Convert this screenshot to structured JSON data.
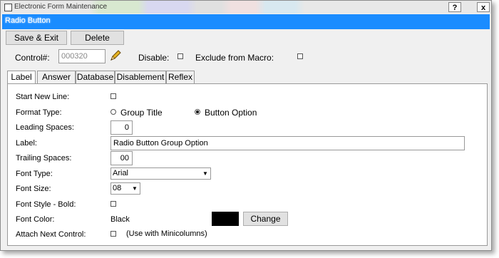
{
  "window": {
    "title": "Electronic Form Maintenance",
    "help_button": "?",
    "close_button": "x"
  },
  "header": {
    "title": "Radio Button"
  },
  "toolbar": {
    "save_exit_label": "Save & Exit",
    "delete_label": "Delete"
  },
  "control": {
    "control_label": "Control#:",
    "control_value": "000320",
    "disable_label": "Disable:",
    "disable_checked": false,
    "exclude_label": "Exclude from Macro:",
    "exclude_checked": false
  },
  "tabs": [
    {
      "label": "Label",
      "active": true
    },
    {
      "label": "Answer",
      "active": false
    },
    {
      "label": "Database",
      "active": false
    },
    {
      "label": "Disablement",
      "active": false
    },
    {
      "label": "Reflex",
      "active": false
    }
  ],
  "form": {
    "start_new_line_label": "Start New Line:",
    "format_type_label": "Format Type:",
    "format_options": [
      "Group Title",
      "Button Option"
    ],
    "format_selected": "Button Option",
    "leading_spaces_label": "Leading Spaces:",
    "leading_spaces_value": "0",
    "label_label": "Label:",
    "label_value": "Radio Button Group Option",
    "trailing_spaces_label": "Trailing Spaces:",
    "trailing_spaces_value": "00",
    "font_type_label": "Font Type:",
    "font_type_value": "Arial",
    "font_size_label": "Font Size:",
    "font_size_value": "08",
    "font_style_label": "Font Style - Bold:",
    "font_color_label": "Font Color:",
    "font_color_value": "Black",
    "font_color_swatch": "#000000",
    "change_label": "Change",
    "attach_label": "Attach Next Control:",
    "attach_note": "(Use with Minicolumns)"
  },
  "colors": {
    "header_bar": "#1a8cff"
  }
}
